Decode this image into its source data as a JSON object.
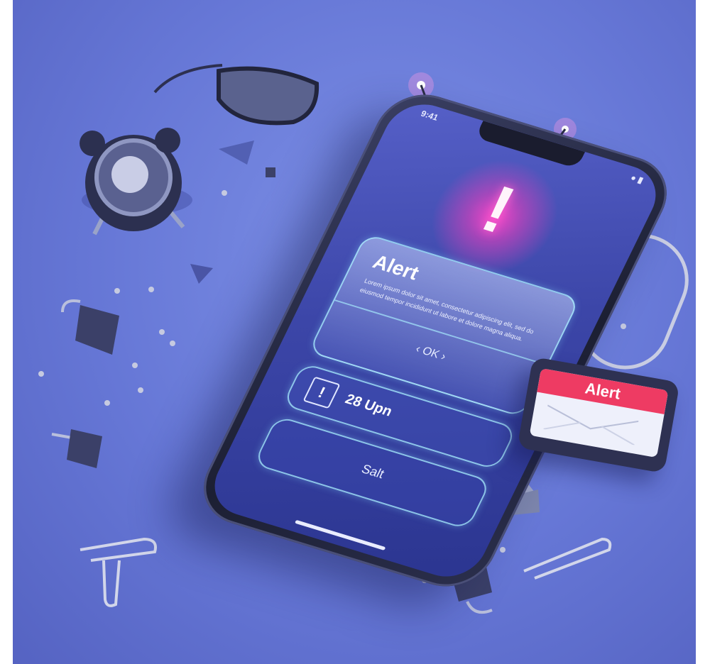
{
  "phone": {
    "status_left": "9:41",
    "status_right": "● ▮",
    "alert_icon": "!",
    "alert": {
      "title": "Alert",
      "body": "Lorem ipsum dolor sit amet, consectetur adipiscing elit, sed do eiusmod tempor incididunt ut labore et dolore magna aliqua.",
      "ok_label": "‹ OK ›"
    },
    "reminder": {
      "icon": "!",
      "text": "28 Upn"
    },
    "action_label": "Salt"
  },
  "badge": {
    "label": "Alert"
  },
  "colors": {
    "background": "#6677d6",
    "glow": "#ff4ec8",
    "badge_header": "#ee3b63",
    "card_border": "#aaf0ff"
  }
}
